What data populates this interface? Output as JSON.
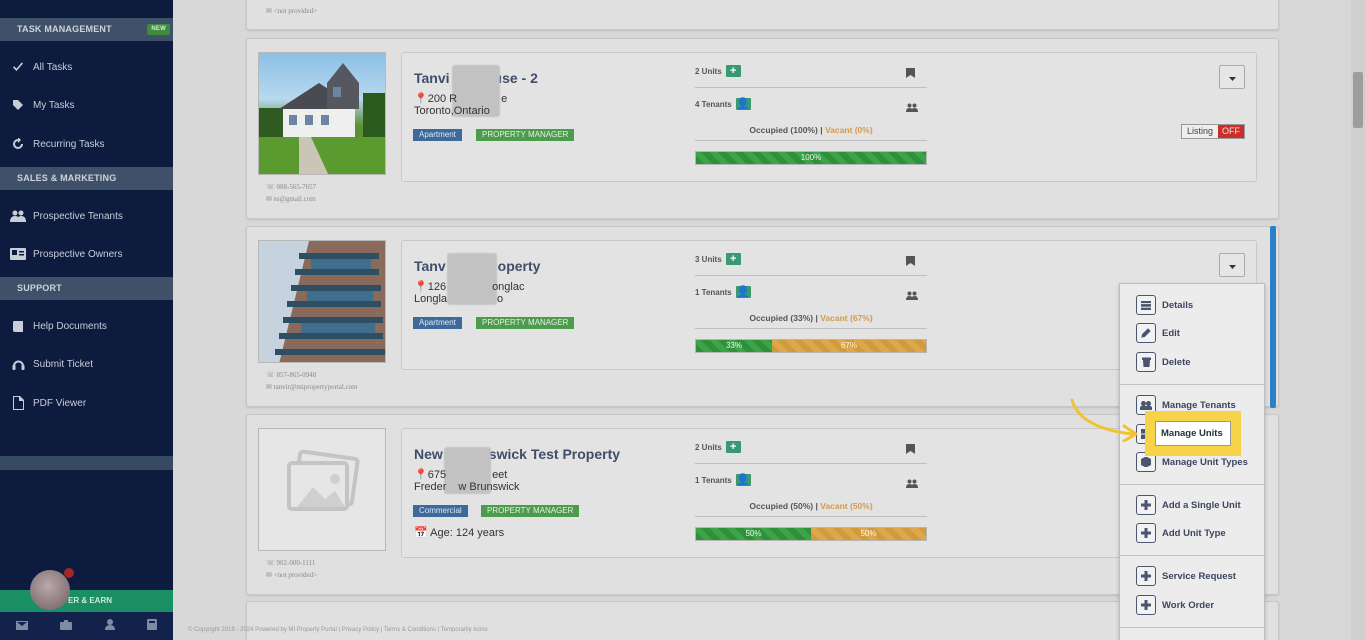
{
  "sidebar": {
    "sections": [
      {
        "label": "TASK MANAGEMENT",
        "badge": "NEW"
      },
      {
        "label": "SALES & MARKETING"
      },
      {
        "label": "SUPPORT"
      }
    ],
    "items": [
      {
        "label": "All Tasks",
        "icon": "check-icon"
      },
      {
        "label": "My Tasks",
        "icon": "tag-icon"
      },
      {
        "label": "Recurring Tasks",
        "icon": "refresh-icon"
      },
      {
        "label": "Prospective Tenants",
        "icon": "users-icon"
      },
      {
        "label": "Prospective Owners",
        "icon": "id-card-icon"
      },
      {
        "label": "Help Documents",
        "icon": "book-icon"
      },
      {
        "label": "Submit Ticket",
        "icon": "headset-icon"
      },
      {
        "label": "PDF Viewer",
        "icon": "pdf-icon"
      }
    ],
    "refer_label": "ER & EARN"
  },
  "top_contact": "<not provided>",
  "properties": [
    {
      "title_left": "Tanvi",
      "title_right": "use - 2",
      "addr1_left": "200 R",
      "addr1_right": "e",
      "addr2_left": "Toronto,Ontario",
      "addr2_right": "",
      "tag1": "Apartment",
      "tag2": "PROPERTY MANAGER",
      "units": "2 Units",
      "tenants": "4 Tenants",
      "occupied": "Occupied (100%)",
      "vacant": "Vacant (0%)",
      "occ_pct": 100,
      "bar_green": "100%",
      "bar_orange": "",
      "phone": "088-565-7657",
      "email": "es@gmail.com",
      "listing": "Listing",
      "listing_state": "OFF"
    },
    {
      "title_left": "Tanv",
      "title_right": "operty",
      "addr1_left": "126",
      "addr1_right": "onglac",
      "addr2_left": "Longla",
      "addr2_right": "o",
      "tag1": "Apartment",
      "tag2": "PROPERTY MANAGER",
      "units": "3 Units",
      "tenants": "1 Tenants",
      "occupied": "Occupied (33%)",
      "vacant": "Vacant (67%)",
      "occ_pct": 33,
      "bar_green": "33%",
      "bar_orange": "67%",
      "phone": "857-865-0948",
      "email": "tanvir@mipropertyportal.com"
    },
    {
      "title_left": "New",
      "title_right": "swick Test Property",
      "addr1_left": "675",
      "addr1_right": "eet",
      "addr2_left": "Freder",
      "addr2_right": "w Brunswick",
      "tag1": "Commercial",
      "tag2": "PROPERTY MANAGER",
      "age": "Age: 124 years",
      "units": "2 Units",
      "tenants": "1 Tenants",
      "occupied": "Occupied (50%)",
      "vacant": "Vacant (50%)",
      "occ_pct": 50,
      "bar_green": "50%",
      "bar_orange": "50%",
      "phone": "902-000-1111",
      "email": "<not provided>"
    }
  ],
  "menu": {
    "items": [
      {
        "label": "Details",
        "icon": "list-icon"
      },
      {
        "label": "Edit",
        "icon": "pencil-icon"
      },
      {
        "label": "Delete",
        "icon": "trash-icon"
      },
      {
        "label": "Manage Tenants",
        "icon": "users-icon"
      },
      {
        "label": "Manage Units",
        "icon": "units-icon"
      },
      {
        "label": "Manage Unit Types",
        "icon": "cube-icon"
      },
      {
        "label": "Add a Single Unit",
        "icon": "plus-icon"
      },
      {
        "label": "Add Unit Type",
        "icon": "plus-icon"
      },
      {
        "label": "Service Request",
        "icon": "plus-icon"
      },
      {
        "label": "Work Order",
        "icon": "plus-icon"
      }
    ],
    "highlight_label": "Manage Units"
  },
  "footer": "© Copyright 2019 - 2024 Powered by MI Property Portal | Privacy Policy | Terms & Conditions | Temporarily Icons",
  "colors": {
    "sidebar_bg": "#0d1b3f",
    "accent_green": "#3a9873",
    "highlight": "#f7d34a"
  }
}
